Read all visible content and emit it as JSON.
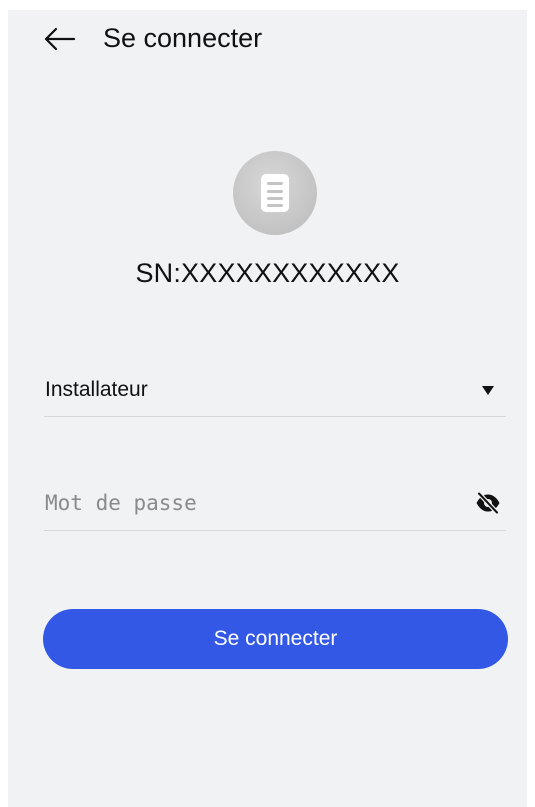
{
  "header": {
    "back_icon": "arrow-left-icon",
    "title": "Se connecter"
  },
  "device": {
    "icon": "document-icon",
    "serial": "SN:XXXXXXXXXXXX"
  },
  "form": {
    "role": {
      "value": "Installateur",
      "dropdown_icon": "caret-down-icon"
    },
    "password": {
      "value": "",
      "placeholder": "Mot de passe",
      "visibility_icon": "eye-off-icon"
    },
    "submit_label": "Se connecter"
  },
  "colors": {
    "background": "#f1f2f4",
    "primary": "#3358e6",
    "icon_circle": "#c6c6c6",
    "divider": "#d6d7da"
  }
}
